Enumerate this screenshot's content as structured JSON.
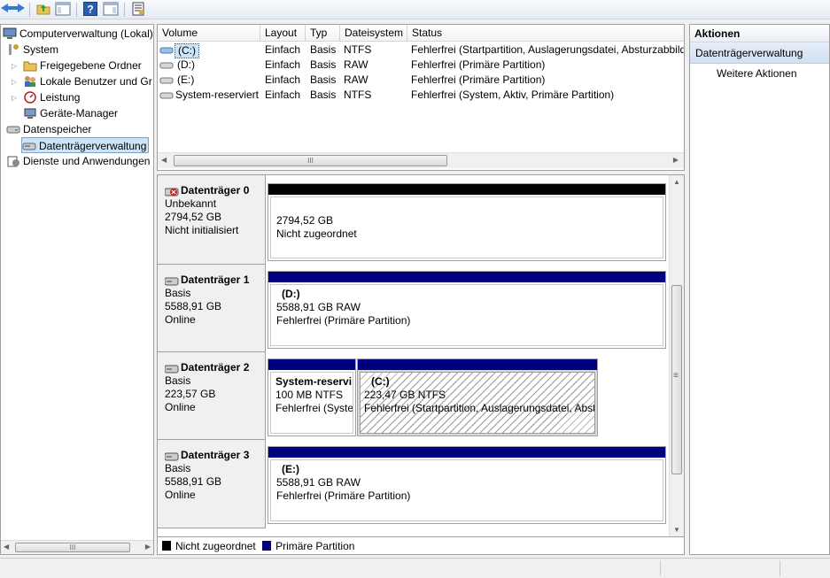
{
  "tree": {
    "root": "Computerverwaltung (Lokal)",
    "items": [
      {
        "label": "System"
      },
      {
        "label": "Freigegebene Ordner"
      },
      {
        "label": "Lokale Benutzer und Gr"
      },
      {
        "label": "Leistung"
      },
      {
        "label": "Geräte-Manager"
      },
      {
        "label": "Datenspeicher"
      },
      {
        "label": "Datenträgerverwaltung"
      },
      {
        "label": "Dienste und Anwendungen"
      }
    ],
    "hscroll_thumb": "III"
  },
  "volumes": {
    "headers": [
      "Volume",
      "Layout",
      "Typ",
      "Dateisystem",
      "Status"
    ],
    "rows": [
      {
        "volume": "(C:)",
        "layout": "Einfach",
        "typ": "Basis",
        "fs": "NTFS",
        "status": "Fehlerfrei (Startpartition, Auslagerungsdatei, Absturzabbild"
      },
      {
        "volume": "(D:)",
        "layout": "Einfach",
        "typ": "Basis",
        "fs": "RAW",
        "status": "Fehlerfrei (Primäre Partition)"
      },
      {
        "volume": "(E:)",
        "layout": "Einfach",
        "typ": "Basis",
        "fs": "RAW",
        "status": "Fehlerfrei (Primäre Partition)"
      },
      {
        "volume": "System-reserviert",
        "layout": "Einfach",
        "typ": "Basis",
        "fs": "NTFS",
        "status": "Fehlerfrei (System, Aktiv, Primäre Partition)"
      }
    ],
    "hscroll_thumb": "III"
  },
  "disks": [
    {
      "name": "Datenträger 0",
      "type": "Unbekannt",
      "size": "2794,52 GB",
      "state": "Nicht initialisiert",
      "partitions": [
        {
          "label": "",
          "size": "2794,52 GB",
          "status": "Nicht zugeordnet"
        }
      ]
    },
    {
      "name": "Datenträger 1",
      "type": "Basis",
      "size": "5588,91 GB",
      "state": "Online",
      "partitions": [
        {
          "label": "(D:)",
          "size": "5588,91 GB RAW",
          "status": "Fehlerfrei (Primäre Partition)"
        }
      ]
    },
    {
      "name": "Datenträger 2",
      "type": "Basis",
      "size": "223,57 GB",
      "state": "Online",
      "partitions": [
        {
          "label": "System-reservi",
          "size": "100 MB NTFS",
          "status": "Fehlerfrei (Syster"
        },
        {
          "label": "(C:)",
          "size": "223,47 GB NTFS",
          "status": "Fehlerfrei (Startpartition, Auslagerungsdatei, Abst"
        }
      ]
    },
    {
      "name": "Datenträger 3",
      "type": "Basis",
      "size": "5588,91 GB",
      "state": "Online",
      "partitions": [
        {
          "label": "(E:)",
          "size": "5588,91 GB RAW",
          "status": "Fehlerfrei (Primäre Partition)"
        }
      ]
    }
  ],
  "graph_vscroll_mark": "≡",
  "legend": [
    {
      "label": "Nicht zugeordnet",
      "color": "#000000"
    },
    {
      "label": "Primäre Partition",
      "color": "#00007f"
    }
  ],
  "actions": {
    "header": "Aktionen",
    "section": "Datenträgerverwaltung",
    "items": [
      "Weitere Aktionen"
    ]
  },
  "colors": {
    "primary_partition": "#00007f",
    "unallocated": "#000000",
    "selection": "#cce4f7"
  }
}
